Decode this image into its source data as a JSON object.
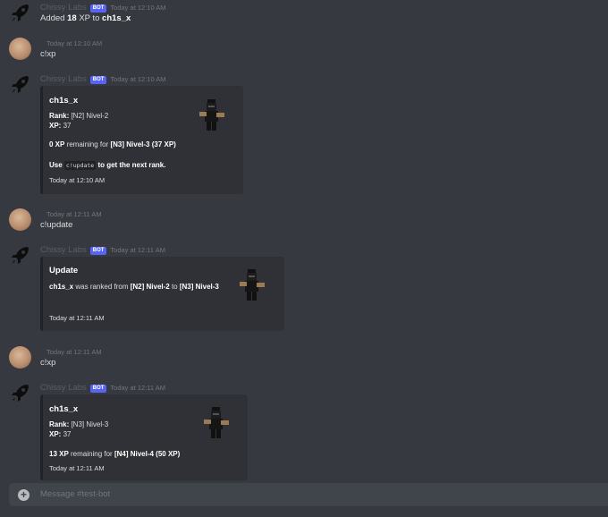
{
  "bot_name": "Chissy Labs",
  "bot_tag": "BOT",
  "msg1": {
    "time": "Today at 12:10 AM",
    "pre": "Added ",
    "amount": "18",
    "mid": " XP to ",
    "user": "ch1s_x"
  },
  "msg2": {
    "time": "Today at 12:10 AM",
    "text": "c!xp"
  },
  "msg3": {
    "time": "Today at 12:10 AM",
    "title": "ch1s_x",
    "rank_label": "Rank:",
    "rank_value": " [N2] Nivel-2",
    "xp_label": "XP:",
    "xp_value": " 37",
    "remaining_amount": "0 XP",
    "remaining_mid": " remaining for ",
    "remaining_target": "[N3] Nivel-3 (37 XP)",
    "use_pre": "Use ",
    "use_code": "c!update",
    "use_post": " to get the next rank.",
    "footer": "Today at 12:10 AM"
  },
  "msg4": {
    "time": "Today at 12:11 AM",
    "text": "c!update"
  },
  "msg5": {
    "time": "Today at 12:11 AM",
    "title": "Update",
    "user": "ch1s_x",
    "mid": " was ranked from ",
    "from": "[N2] Nivel-2",
    "to_word": " to ",
    "to": "[N3] Nivel-3",
    "footer": "Today at 12:11 AM"
  },
  "msg6": {
    "time": "Today at 12:11 AM",
    "text": "c!xp"
  },
  "msg7": {
    "time": "Today at 12:11 AM",
    "title": "ch1s_x",
    "rank_label": "Rank:",
    "rank_value": " [N3] Nivel-3",
    "xp_label": "XP:",
    "xp_value": " 37",
    "remaining_amount": "13 XP",
    "remaining_mid": " remaining for ",
    "remaining_target": "[N4] Nivel-4 (50 XP)",
    "footer": "Today at 12:11 AM"
  },
  "composer": {
    "placeholder": "Message #test-bot"
  }
}
